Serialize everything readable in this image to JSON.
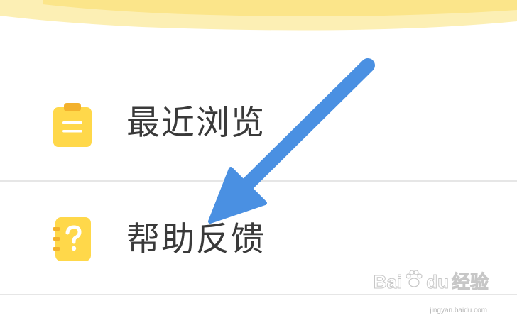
{
  "menu": {
    "items": [
      {
        "label": "最近浏览",
        "icon": "clipboard-icon"
      },
      {
        "label": "帮助反馈",
        "icon": "help-notebook-icon"
      }
    ]
  },
  "watermark": {
    "brand_a": "Bai",
    "brand_b": "du",
    "brand_c": "经验",
    "domain": "jingyan.baidu.com"
  },
  "colors": {
    "accent_yellow": "#FFD84A",
    "banner_yellow": "#FCEFB4",
    "arrow_blue": "#4A90E2",
    "text": "#3A3A3A",
    "divider": "#E6E6E6"
  }
}
